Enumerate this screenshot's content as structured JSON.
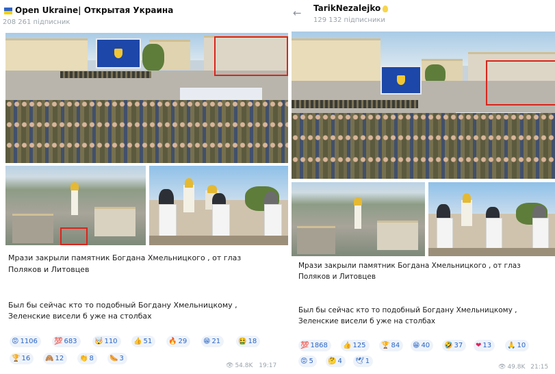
{
  "post_left": {
    "channel_name": "Open Ukraine| Открытая Украина",
    "subscribers": "208 261 підписник",
    "text_line1": "Мрази закрыли памятник Богдана Хмельницкого , от глаз",
    "text_line2": "Поляков и Литовцев",
    "text_line3": "Был бы сейчас кто то подобный Богдану Хмельницкому ,",
    "text_line4": "Зеленские висели б уже на столбах",
    "reactions": [
      {
        "icon": "😡",
        "icon_name": "angry-face-icon",
        "count": "1106"
      },
      {
        "icon": "💯",
        "icon_name": "hundred-points-icon",
        "count": "683"
      },
      {
        "icon": "🤯",
        "icon_name": "exploding-head-icon",
        "count": "110"
      },
      {
        "icon": "👍",
        "icon_name": "thumbs-up-icon",
        "count": "51"
      },
      {
        "icon": "🔥",
        "icon_name": "fire-icon",
        "count": "29"
      },
      {
        "icon": "😁",
        "icon_name": "grinning-face-icon",
        "count": "21"
      },
      {
        "icon": "🤮",
        "icon_name": "vomiting-face-icon",
        "count": "18"
      },
      {
        "icon": "🏆",
        "icon_name": "trophy-icon",
        "count": "16"
      },
      {
        "icon": "🙈",
        "icon_name": "see-no-evil-monkey-icon",
        "count": "12"
      },
      {
        "icon": "👏",
        "icon_name": "clapping-hands-icon",
        "count": "8"
      },
      {
        "icon": "🌭",
        "icon_name": "hot-dog-icon",
        "count": "3"
      }
    ],
    "views": "54.8K",
    "time": "19:17"
  },
  "post_right": {
    "channel_name": "TarikNezalejko",
    "subscribers": "129 132 підписники",
    "text_line1": "Мрази закрыли памятник Богдана Хмельницкого , от глаз",
    "text_line2": "Поляков и Литовцев",
    "text_line3": "Был бы сейчас кто то подобный Богдану Хмельницкому ,",
    "text_line4": "Зеленские висели б уже на столбах",
    "reactions": [
      {
        "icon": "💯",
        "icon_name": "hundred-points-icon",
        "count": "1868"
      },
      {
        "icon": "👍",
        "icon_name": "thumbs-up-icon",
        "count": "125"
      },
      {
        "icon": "🏆",
        "icon_name": "trophy-icon",
        "count": "84"
      },
      {
        "icon": "😁",
        "icon_name": "grinning-face-icon",
        "count": "40"
      },
      {
        "icon": "🤣",
        "icon_name": "rolling-laughing-icon",
        "count": "37"
      },
      {
        "icon": "❤",
        "icon_name": "heart-icon",
        "count": "13"
      },
      {
        "icon": "🙏",
        "icon_name": "folded-hands-icon",
        "count": "10"
      },
      {
        "icon": "😡",
        "icon_name": "angry-face-icon",
        "count": "5"
      },
      {
        "icon": "🤔",
        "icon_name": "thinking-face-icon",
        "count": "4"
      },
      {
        "icon": "🕊",
        "icon_name": "dove-icon",
        "count": "1"
      }
    ],
    "views": "49.8K",
    "time": "21:15"
  },
  "colors": {
    "reaction_text": "#2a66c4",
    "reaction_bg": "#eef3fa",
    "highlight_box": "#d9251c",
    "flag_blue": "#2f64c8",
    "flag_yellow": "#f5d000"
  }
}
